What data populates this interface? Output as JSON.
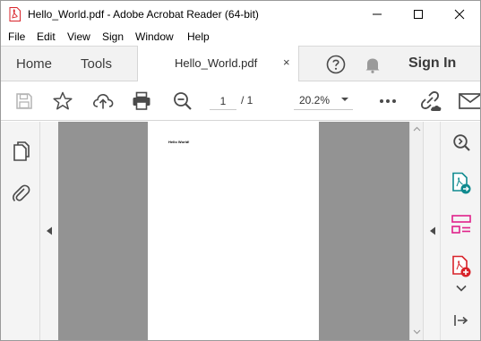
{
  "window": {
    "title": "Hello_World.pdf - Adobe Acrobat Reader (64-bit)",
    "controls": [
      "minimize",
      "maximize",
      "close"
    ]
  },
  "menu": {
    "items": [
      "File",
      "Edit",
      "View",
      "Sign",
      "Window",
      "Help"
    ]
  },
  "tabs": {
    "home": "Home",
    "tools": "Tools",
    "document": "Hello_World.pdf",
    "close_glyph": "×",
    "sign_in": "Sign In",
    "icons": [
      "help-icon",
      "bell-icon"
    ]
  },
  "toolbar": {
    "icons": [
      "save-icon",
      "star-icon",
      "upload-icon",
      "print-icon",
      "zoom-out-icon",
      "more-icon",
      "link-icon",
      "email-icon"
    ],
    "page_current": "1",
    "page_total": "/ 1",
    "zoom": "20.2%"
  },
  "left_panel": {
    "icons": [
      "pages-icon",
      "attachment-icon"
    ]
  },
  "document": {
    "text": "Hello World!"
  },
  "right_panel": {
    "icons": [
      "zoom-icon",
      "export-pdf-icon",
      "organize-pages-icon",
      "create-pdf-icon",
      "chevron-down-icon",
      "collapse-pane-icon"
    ]
  },
  "colors": {
    "accent_red": "#d8232a",
    "teal": "#0f8a8f",
    "magenta": "#e0218a",
    "doc_bg": "#939393"
  }
}
